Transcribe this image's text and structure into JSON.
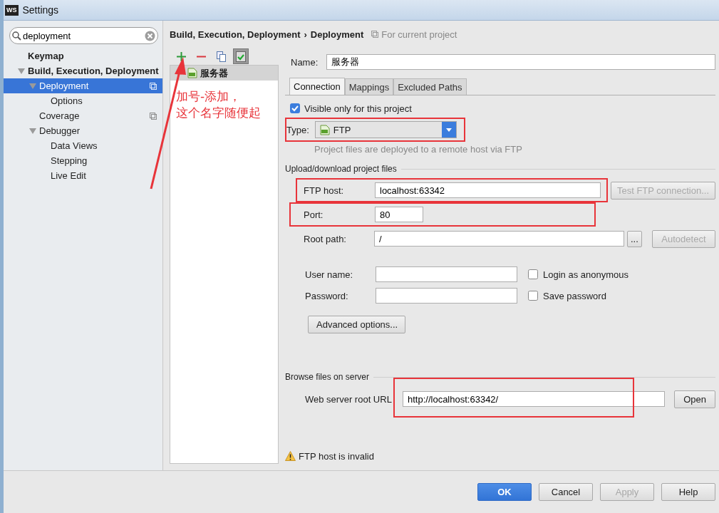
{
  "window": {
    "logo": "WS",
    "title": "Settings"
  },
  "search": {
    "value": "deployment"
  },
  "tree": [
    {
      "label": "Keymap",
      "selected": false
    },
    {
      "label": "Build, Execution, Deployment",
      "selected": false,
      "expanded": true,
      "children": [
        {
          "label": "Deployment",
          "selected": true,
          "expanded": true,
          "scoped": true,
          "children": [
            {
              "label": "Options",
              "selected": false
            }
          ]
        },
        {
          "label": "Coverage",
          "selected": false,
          "scoped": true
        },
        {
          "label": "Debugger",
          "selected": false,
          "expanded": true,
          "children": [
            {
              "label": "Data Views",
              "selected": false
            },
            {
              "label": "Stepping",
              "selected": false
            },
            {
              "label": "Live Edit",
              "selected": false
            }
          ]
        }
      ]
    }
  ],
  "breadcrumb": {
    "path": [
      "Build, Execution, Deployment",
      "Deployment"
    ],
    "separator": "›",
    "scope": "For current project"
  },
  "servers": {
    "tools": [
      {
        "kind": "add",
        "on": false
      },
      {
        "kind": "remove",
        "on": false
      },
      {
        "kind": "copy",
        "on": false
      },
      {
        "kind": "check",
        "on": true
      }
    ],
    "items": [
      {
        "name": "服务器",
        "selected": true
      }
    ]
  },
  "annotation": {
    "lines": [
      "加号-添加，",
      "这个名字随便起"
    ]
  },
  "form": {
    "name": {
      "label": "Name:",
      "value": "服务器"
    },
    "tabs": [
      {
        "label": "Connection",
        "selected": true
      },
      {
        "label": "Mappings",
        "selected": false
      },
      {
        "label": "Excluded Paths",
        "selected": false
      }
    ],
    "visible_only": {
      "label": "Visible only for this project",
      "checked": true
    },
    "type": {
      "label": "Type:",
      "value": "FTP",
      "hint": "Project files are deployed to a remote host via FTP",
      "highlighted": true
    },
    "upload_section": "Upload/download project files",
    "ftp_host": {
      "label": "FTP host:",
      "value": "localhost:63342",
      "highlighted": true,
      "button": {
        "label": "Test FTP connection...",
        "disabled": true
      }
    },
    "port": {
      "label": "Port:",
      "value": "80",
      "highlighted": true
    },
    "root_path": {
      "label": "Root path:",
      "value": "/",
      "browse": "...",
      "button": {
        "label": "Autodetect",
        "disabled": true
      }
    },
    "user_name": {
      "label": "User name:",
      "option": {
        "label": "Login as anonymous",
        "checked": false
      }
    },
    "password": {
      "label": "Password:",
      "option": {
        "label": "Save password",
        "checked": false
      }
    },
    "advanced": "Advanced options...",
    "browse_section": "Browse files on server",
    "web_url": {
      "label": "Web server root URL",
      "value": "http://localhost:63342/",
      "highlighted": true,
      "button": "Open"
    },
    "warning": "FTP host is invalid"
  },
  "footer": [
    {
      "label": "OK",
      "primary": true,
      "disabled": false
    },
    {
      "label": "Cancel",
      "primary": false,
      "disabled": false
    },
    {
      "label": "Apply",
      "primary": false,
      "disabled": true
    },
    {
      "label": "Help",
      "primary": false,
      "disabled": false
    }
  ]
}
